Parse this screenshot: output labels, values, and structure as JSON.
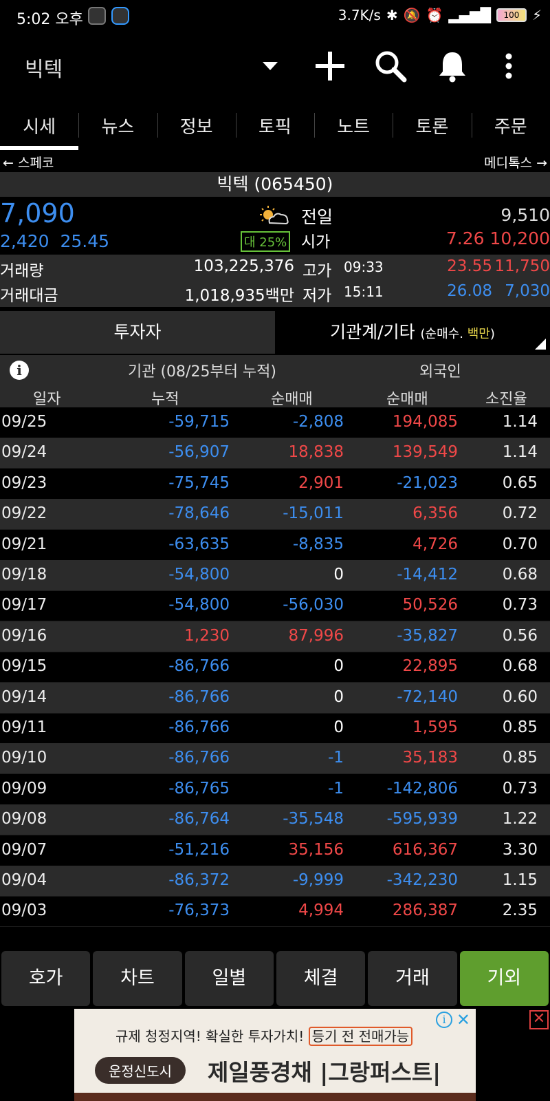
{
  "statusbar": {
    "time": "5:02 오후",
    "right_text": "3.7K/s",
    "battery": "100"
  },
  "appbar": {
    "title": "빅텍",
    "icons": [
      "dropdown-icon",
      "plus-icon",
      "search-icon",
      "bell-icon",
      "more-icon"
    ]
  },
  "tabs": [
    "시세",
    "뉴스",
    "정보",
    "토픽",
    "노트",
    "토론",
    "주문"
  ],
  "nav": {
    "prev": "← 스페코",
    "next": "메디톡스 →"
  },
  "stock": {
    "name_code": "빅텍 (065450)",
    "price": "7,090",
    "change": "2,420",
    "change_pct": "25.45",
    "ratio_badge": "대 25%",
    "prev_label": "전일",
    "prev_value": "9,510",
    "open_label": "시가",
    "open_pct": "7.26",
    "open_value": "10,200",
    "volume_label": "거래량",
    "volume_value": "103,225,376",
    "amount_label": "거래대금",
    "amount_value": "1,018,935백만",
    "high_label": "고가",
    "high_time": "09:33",
    "high_pct": "23.55",
    "high_value": "11,750",
    "low_label": "저가",
    "low_time": "15:11",
    "low_pct": "26.08",
    "low_value": "7,030"
  },
  "investor_tabs": {
    "tab1": "투자자",
    "tab2_main": "기관계/기타",
    "tab2_sub_pre": "(순매수.",
    "tab2_sub_unit": "백만",
    "tab2_sub_post": ")"
  },
  "table": {
    "group_institution": "기관 (08/25부터 누적)",
    "group_foreign": "외국인",
    "col_date": "일자",
    "col_cumulative": "누적",
    "col_inst_net": "순매매",
    "col_foreign_net": "순매매",
    "col_exhaustion": "소진율",
    "rows": [
      {
        "date": "09/25",
        "cum": "-59,715",
        "inst": "-2,808",
        "foreign": "194,085",
        "rate": "1.14"
      },
      {
        "date": "09/24",
        "cum": "-56,907",
        "inst": "18,838",
        "foreign": "139,549",
        "rate": "1.14"
      },
      {
        "date": "09/23",
        "cum": "-75,745",
        "inst": "2,901",
        "foreign": "-21,023",
        "rate": "0.65"
      },
      {
        "date": "09/22",
        "cum": "-78,646",
        "inst": "-15,011",
        "foreign": "6,356",
        "rate": "0.72"
      },
      {
        "date": "09/21",
        "cum": "-63,635",
        "inst": "-8,835",
        "foreign": "4,726",
        "rate": "0.70"
      },
      {
        "date": "09/18",
        "cum": "-54,800",
        "inst": "0",
        "foreign": "-14,412",
        "rate": "0.68"
      },
      {
        "date": "09/17",
        "cum": "-54,800",
        "inst": "-56,030",
        "foreign": "50,526",
        "rate": "0.73"
      },
      {
        "date": "09/16",
        "cum": "1,230",
        "inst": "87,996",
        "foreign": "-35,827",
        "rate": "0.56"
      },
      {
        "date": "09/15",
        "cum": "-86,766",
        "inst": "0",
        "foreign": "22,895",
        "rate": "0.68"
      },
      {
        "date": "09/14",
        "cum": "-86,766",
        "inst": "0",
        "foreign": "-72,140",
        "rate": "0.60"
      },
      {
        "date": "09/11",
        "cum": "-86,766",
        "inst": "0",
        "foreign": "1,595",
        "rate": "0.85"
      },
      {
        "date": "09/10",
        "cum": "-86,766",
        "inst": "-1",
        "foreign": "35,183",
        "rate": "0.85"
      },
      {
        "date": "09/09",
        "cum": "-86,765",
        "inst": "-1",
        "foreign": "-142,806",
        "rate": "0.73"
      },
      {
        "date": "09/08",
        "cum": "-86,764",
        "inst": "-35,548",
        "foreign": "-595,939",
        "rate": "1.22"
      },
      {
        "date": "09/07",
        "cum": "-51,216",
        "inst": "35,156",
        "foreign": "616,367",
        "rate": "3.30"
      },
      {
        "date": "09/04",
        "cum": "-86,372",
        "inst": "-9,999",
        "foreign": "-342,230",
        "rate": "1.15"
      },
      {
        "date": "09/03",
        "cum": "-76,373",
        "inst": "4,994",
        "foreign": "286,387",
        "rate": "2.35"
      }
    ]
  },
  "bottom_buttons": [
    "호가",
    "차트",
    "일별",
    "체결",
    "거래",
    "기외"
  ],
  "ad": {
    "line1_pre": "규제 청정지역! 확실한 투자가치!",
    "line1_box": "등기 전 전매가능",
    "pill": "운정신도시",
    "line2": "제일풍경채 |그랑퍼스트|"
  },
  "colors": {
    "up": "#f04848",
    "down": "#3d8ef0",
    "active_button": "#5f9e2e"
  }
}
